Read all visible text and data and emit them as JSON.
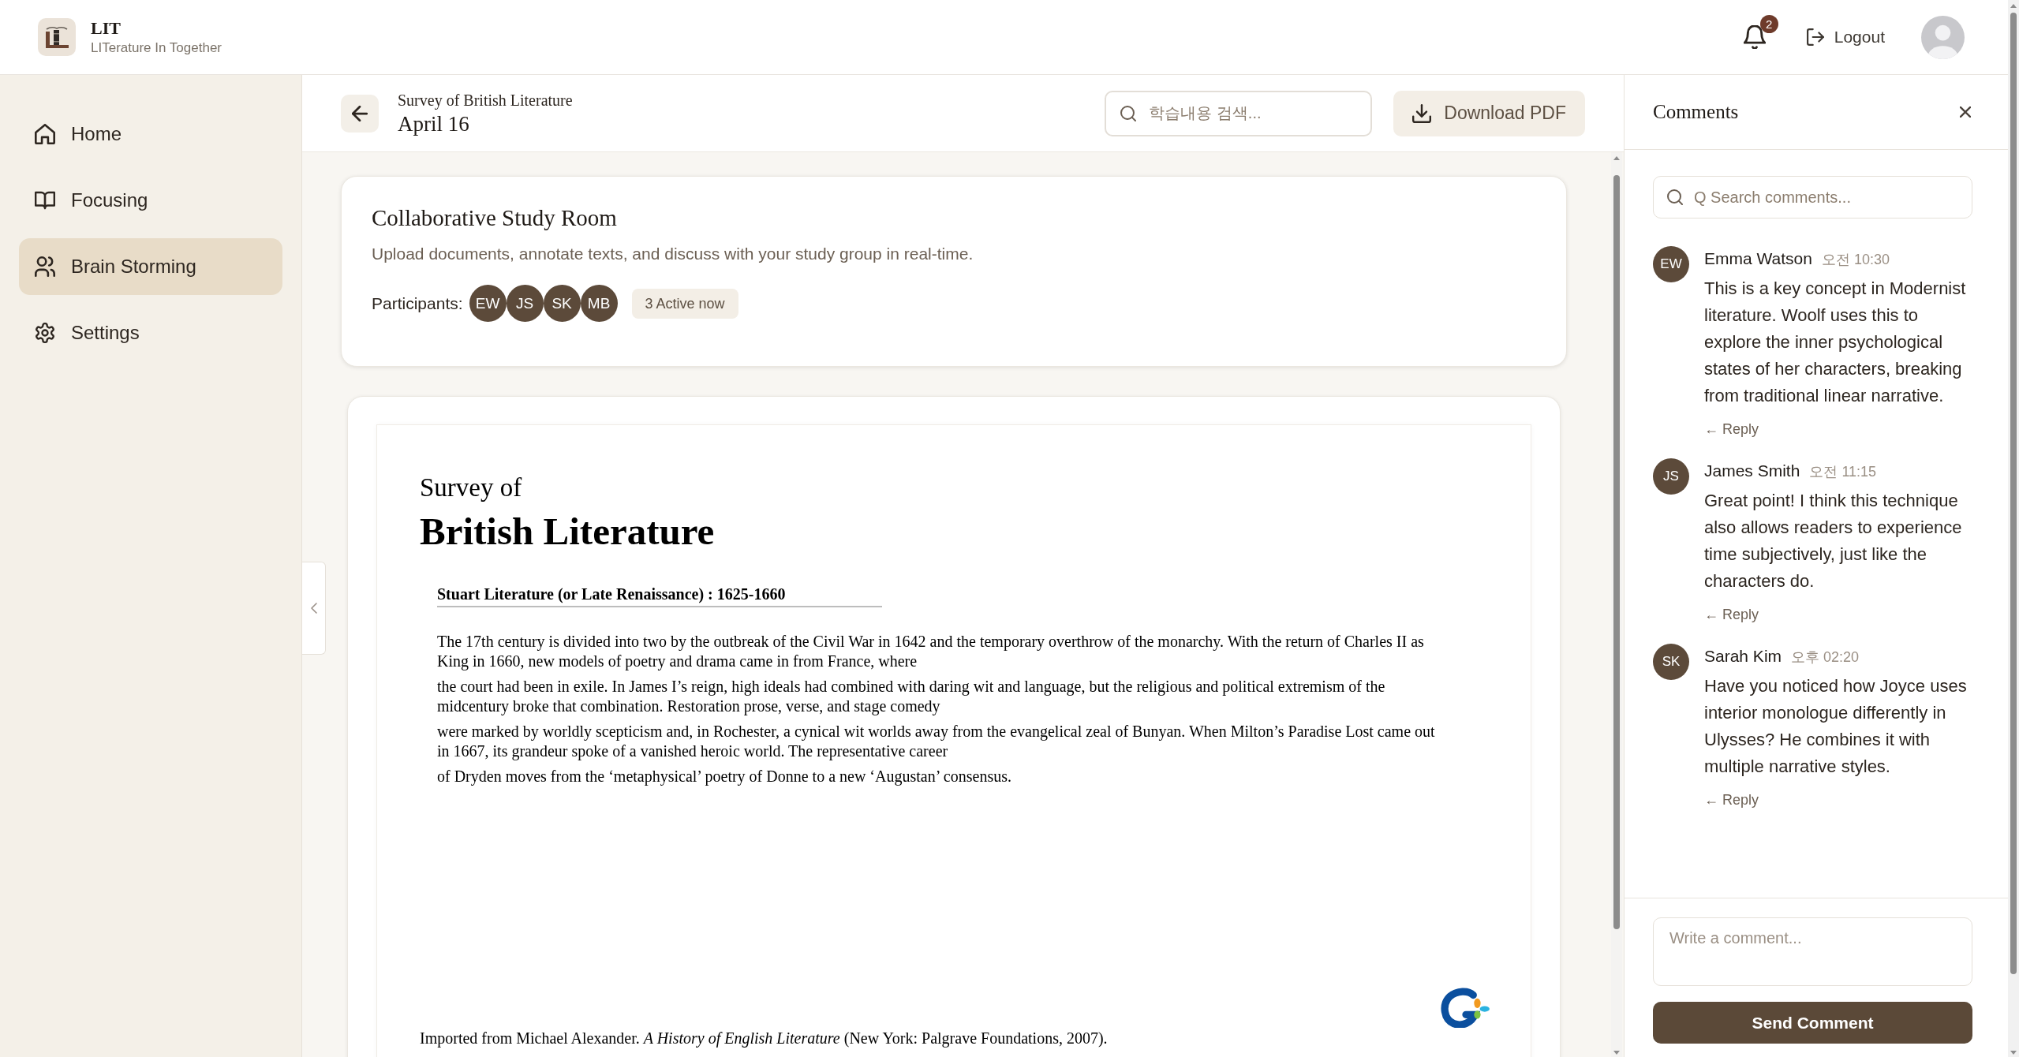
{
  "header": {
    "logo": {
      "title": "LIT",
      "subtitle": "LITerature In Together"
    },
    "notifications": {
      "count": "2"
    },
    "logout": {
      "label": "Logout"
    }
  },
  "sidebar": {
    "items": [
      {
        "label": "Home",
        "selected": false
      },
      {
        "label": "Focusing",
        "selected": false
      },
      {
        "label": "Brain Storming",
        "selected": true
      },
      {
        "label": "Settings",
        "selected": false
      }
    ]
  },
  "toolbar": {
    "course": "Survey of British Literature",
    "date": "April 16",
    "search": {
      "placeholder": "학습내용 검색..."
    },
    "download_button": "Download PDF"
  },
  "study_room": {
    "title": "Collaborative Study Room",
    "description": "Upload documents, annotate texts, and discuss with your study group in real-time.",
    "participants_label": "Participants:",
    "participants": [
      "EW",
      "JS",
      "SK",
      "MB"
    ],
    "active_badge": "3 Active now"
  },
  "document": {
    "title_small": "Survey of",
    "title": "British Literature",
    "section_heading": "Stuart Literature (or Late Renaissance) : 1625-1660",
    "paragraphs": [
      [
        "The 17th century is divided into two by the outbreak of the Civil War in 1642 and the temporary overthrow of the monarchy. With the return of Charles II as",
        "King in 1660, new models of poetry and drama came in from France, where"
      ],
      [
        "the court had been in exile. In James I’s reign, high ideals had combined with daring wit and language, but the religious and political extremism of the",
        "midcentury broke that combination. Restoration prose, verse, and stage comedy"
      ],
      [
        "were marked by worldly scepticism and, in Rochester, a cynical wit worlds away from the evangelical zeal of Bunyan. When Milton’s Paradise Lost came out",
        "in 1667, its grandeur spoke of a vanished heroic world. The representative career"
      ],
      [
        "of Dryden moves from the ‘metaphysical’ poetry of Donne to a new ‘Augustan’ consensus."
      ]
    ],
    "footnote": "Imported from Michael Alexander. *A History of English Literature* (New York: Palgrave Foundations, 2007)."
  },
  "comments": {
    "title": "Comments",
    "search": {
      "placeholder": "Q Search comments..."
    },
    "items": [
      {
        "initials": "EW",
        "author": "Emma Watson",
        "time": "오전 10:30",
        "text": "This is a key concept in Modernist literature. Woolf uses this to explore the inner psychological states of her characters, breaking from traditional linear narrative.",
        "reply": "← Reply"
      },
      {
        "initials": "JS",
        "author": "James Smith",
        "time": "오전 11:15",
        "text": "Great point! I think this technique also allows readers to experience time subjectively, just like the characters do.",
        "reply": "← Reply"
      },
      {
        "initials": "SK",
        "author": "Sarah Kim",
        "time": "오후 02:20",
        "text": "Have you noticed how Joyce uses interior monologue differently in Ulysses? He combines it with multiple narrative styles.",
        "reply": "← Reply"
      }
    ],
    "composer": {
      "placeholder": "Write a comment..."
    },
    "send_button": "Send Comment"
  }
}
